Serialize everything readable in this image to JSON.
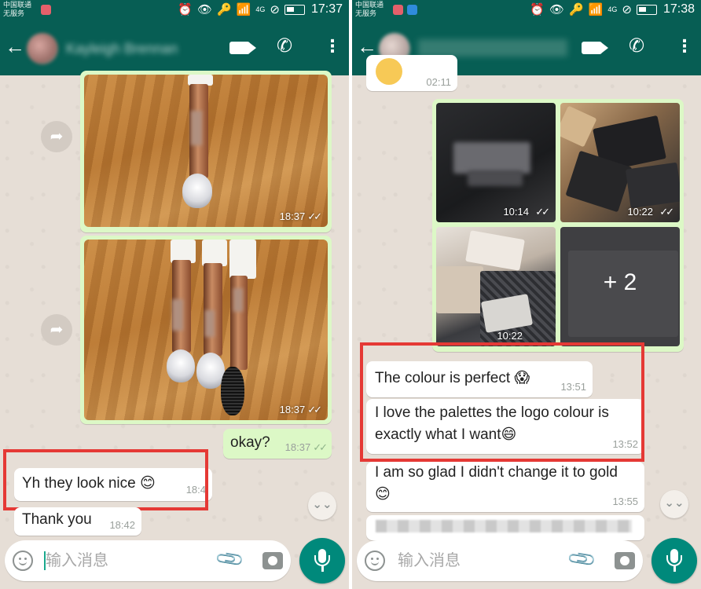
{
  "left": {
    "status": {
      "carrier_line1": "中国联通",
      "carrier_line2": "无服务",
      "network": "4G",
      "time": "17:37"
    },
    "header": {
      "contact_name": "Kayleigh Brennan",
      "back_icon": "arrow-left-icon",
      "video_icon": "video-call-icon",
      "call_icon": "phone-icon",
      "menu_icon": "more-vert-icon"
    },
    "messages": [
      {
        "type": "image",
        "direction": "out",
        "time": "18:37",
        "ticks": "✓✓"
      },
      {
        "type": "image",
        "direction": "out",
        "time": "18:37",
        "ticks": "✓✓"
      },
      {
        "type": "text",
        "direction": "out",
        "text": "okay?",
        "time": "18:37",
        "ticks": "✓✓"
      },
      {
        "type": "text",
        "direction": "in",
        "text": "Yh they look nice 😊",
        "time": "18:4"
      },
      {
        "type": "text",
        "direction": "in",
        "text": "Thank you",
        "time": "18:42"
      }
    ],
    "input": {
      "placeholder": "输入消息"
    },
    "forward_glyph": "➦",
    "scroll_glyph": "⌄⌄"
  },
  "right": {
    "status": {
      "network": "4G",
      "time": "17:38"
    },
    "header": {
      "contact_name": "Contact",
      "back_icon": "arrow-left-icon",
      "video_icon": "video-call-icon",
      "call_icon": "phone-icon",
      "menu_icon": "more-vert-icon"
    },
    "top_message_time": "02:11",
    "gallery": {
      "tiles": [
        {
          "time": "10:14",
          "ticks": "✓✓"
        },
        {
          "time": "10:22",
          "ticks": "✓✓"
        },
        {
          "time": "10:22",
          "ticks": ""
        },
        {
          "more_count": "+ 2"
        }
      ]
    },
    "messages": [
      {
        "type": "text",
        "direction": "in",
        "text": "The colour is perfect 😱",
        "time": "13:51"
      },
      {
        "type": "text",
        "direction": "in",
        "text_line1": "I love the palettes the logo colour is",
        "text_line2": "exactly what I want😄",
        "time": "13:52"
      },
      {
        "type": "text",
        "direction": "in",
        "text_line1": "I am so glad I didn't change it to gold",
        "text_line2": "😊",
        "time": "13:55"
      }
    ],
    "input": {
      "placeholder": "输入消息"
    },
    "scroll_glyph": "⌄⌄"
  },
  "colors": {
    "toolbar": "#075e54",
    "outgoing_bubble": "#dcf8c6",
    "incoming_bubble": "#ffffff",
    "wallpaper": "#e5ddd5",
    "highlight_box": "#e53935",
    "mic_button": "#00897b"
  }
}
